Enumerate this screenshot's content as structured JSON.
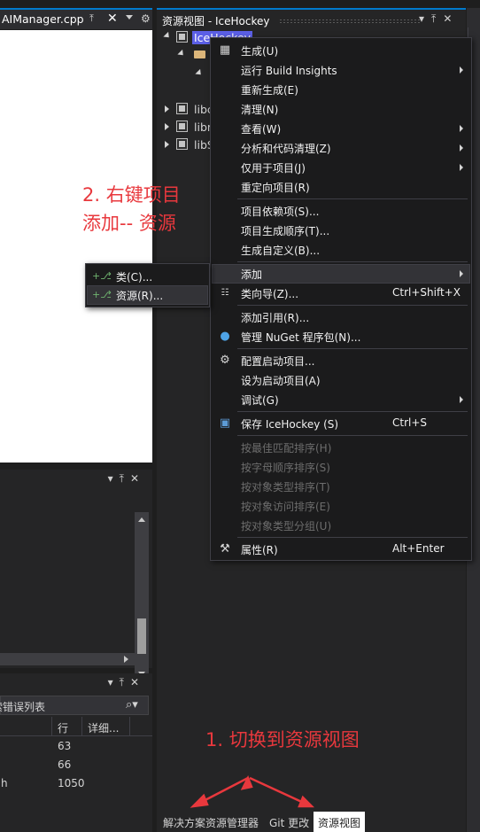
{
  "editor": {
    "tab_title": "AIManager.cpp",
    "pin_icon": "pin-icon",
    "close_icon": "close-icon",
    "dropdown_icon": "chevron-down-icon",
    "settings_icon": "gear-icon"
  },
  "error_list": {
    "filter_label": "搜索错误列表",
    "columns": [
      "行",
      "详细..."
    ],
    "rows": [
      {
        "file": "",
        "line": "63"
      },
      {
        "file": "",
        "line": "66"
      },
      {
        "file": "h",
        "line": "1050"
      }
    ]
  },
  "solution_panel": {
    "title": "资源视图 - IceHockey",
    "tree": [
      {
        "label": "IceHockey",
        "selected": true
      },
      {
        "label": "",
        "type": "folder"
      },
      {
        "label": "",
        "type": "item"
      },
      {
        "label": "libc"
      },
      {
        "label": "libr"
      },
      {
        "label": "libS"
      }
    ],
    "bottom_tabs": [
      "解决方案资源管理器",
      "Git 更改",
      "资源视图"
    ],
    "active_tab": "资源视图"
  },
  "context_menu": {
    "items": [
      {
        "label": "生成(U)",
        "icon": "build-icon"
      },
      {
        "label": "运行 Build Insights",
        "submenu": true
      },
      {
        "label": "重新生成(E)"
      },
      {
        "label": "清理(N)"
      },
      {
        "label": "查看(W)",
        "submenu": true
      },
      {
        "label": "分析和代码清理(Z)",
        "submenu": true
      },
      {
        "label": "仅用于项目(J)",
        "submenu": true
      },
      {
        "label": "重定向项目(R)"
      },
      {
        "label": "项目依赖项(S)..."
      },
      {
        "label": "项目生成顺序(T)..."
      },
      {
        "label": "生成自定义(B)..."
      },
      {
        "label": "添加",
        "submenu": true,
        "highlighted": true
      },
      {
        "label": "类向导(Z)...",
        "shortcut": "Ctrl+Shift+X",
        "icon": "class-wizard-icon"
      },
      {
        "label": "添加引用(R)..."
      },
      {
        "label": "管理 NuGet 程序包(N)...",
        "icon": "nuget-icon"
      },
      {
        "label": "配置启动项目...",
        "icon": "gear-icon"
      },
      {
        "label": "设为启动项目(A)"
      },
      {
        "label": "调试(G)",
        "submenu": true
      },
      {
        "label": "保存 IceHockey (S)",
        "shortcut": "Ctrl+S",
        "icon": "save-icon"
      },
      {
        "label": "按最佳匹配排序(H)",
        "disabled": true
      },
      {
        "label": "按字母顺序排序(S)",
        "disabled": true
      },
      {
        "label": "按对象类型排序(T)",
        "disabled": true
      },
      {
        "label": "按对象访问排序(E)",
        "disabled": true
      },
      {
        "label": "按对象类型分组(U)",
        "disabled": true
      },
      {
        "label": "属性(R)",
        "shortcut": "Alt+Enter",
        "icon": "wrench-icon"
      }
    ]
  },
  "sub_menu": {
    "items": [
      {
        "label": "类(C)..."
      },
      {
        "label": "资源(R)...",
        "highlighted": true
      }
    ]
  },
  "annotations": {
    "step2_line1": "2. 右键项目",
    "step2_line2": "添加-- 资源",
    "step1": "1. 切换到资源视图"
  },
  "colors": {
    "accent": "#007acc",
    "annotation": "#e8383d",
    "selection": "#5b5fe6"
  }
}
